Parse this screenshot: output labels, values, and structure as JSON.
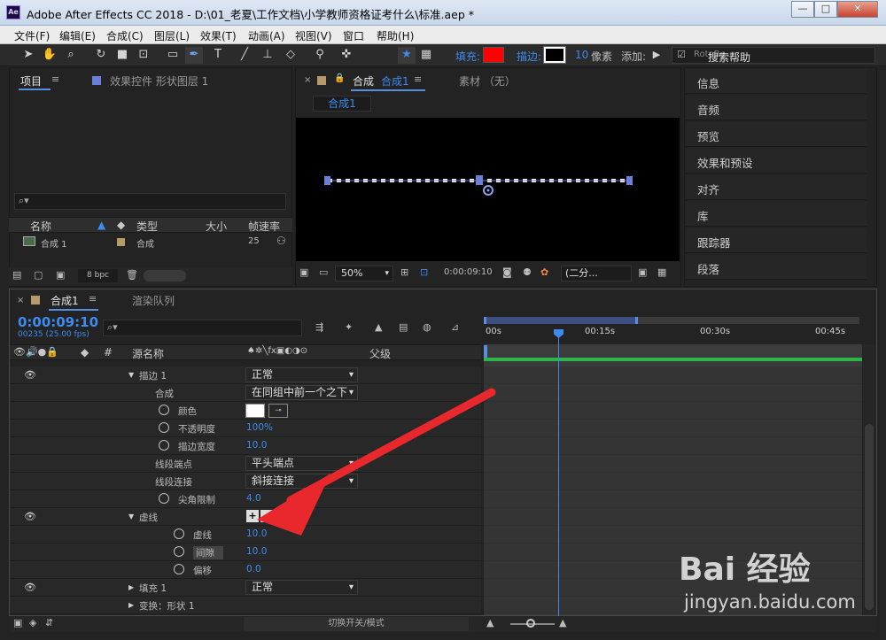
{
  "window": {
    "title": "Adobe After Effects CC 2018 - D:\\01_老夏\\工作文档\\小学教师资格证考什么\\标准.aep *",
    "logo": "Ae"
  },
  "menu": [
    "文件(F)",
    "编辑(E)",
    "合成(C)",
    "图层(L)",
    "效果(T)",
    "动画(A)",
    "视图(V)",
    "窗口",
    "帮助(H)"
  ],
  "toolbar": {
    "fill_label": "填充:",
    "stroke_label": "描边:",
    "stroke_width": "10",
    "stroke_unit": "像素",
    "add_label": "添加:",
    "search_placeholder": "搜索帮助",
    "rotobe_label": "RotoBe",
    "fill_color": "#ff0000",
    "stroke_color": "#000000"
  },
  "project_panel": {
    "tab_project": "项目",
    "tab_effects": "效果控件 形状图层 1",
    "columns": {
      "name": "名称",
      "type": "类型",
      "size": "大小",
      "fps": "帧速率"
    },
    "row": {
      "name": "合成 1",
      "type": "合成",
      "fps": "25"
    },
    "bpc": "8 bpc"
  },
  "comp_panel": {
    "tab_comp_prefix": "合成",
    "tab_comp_name": "合成1",
    "tab_footage": "素材 （无）",
    "breadcrumb": "合成1",
    "zoom": "50%",
    "timecode": "0:00:09:10",
    "resolution": "(二分..."
  },
  "right_panel": {
    "items": [
      "信息",
      "音频",
      "预览",
      "效果和预设",
      "对齐",
      "库",
      "跟踪器",
      "段落"
    ]
  },
  "timeline": {
    "tab_comp": "合成1",
    "tab_render": "渲染队列",
    "timecode": "0:00:09:10",
    "frames": "00235 (25.00 fps)",
    "col_source": "源名称",
    "col_parent": "父级",
    "ruler": [
      "00s",
      "00:15s",
      "00:30s",
      "00:45s"
    ],
    "footer_toggle": "切换开关/模式"
  },
  "layers": [
    {
      "label": "描边 1",
      "value": "正常",
      "kind": "dd"
    },
    {
      "label": "合成",
      "value": "在同组中前一个之下",
      "kind": "dd"
    },
    {
      "label": "颜色",
      "value": "",
      "kind": "color"
    },
    {
      "label": "不透明度",
      "value": "100%",
      "kind": "num"
    },
    {
      "label": "描边宽度",
      "value": "10.0",
      "kind": "num"
    },
    {
      "label": "线段端点",
      "value": "平头端点",
      "kind": "dd"
    },
    {
      "label": "线段连接",
      "value": "斜接连接",
      "kind": "dd"
    },
    {
      "label": "尖角限制",
      "value": "4.0",
      "kind": "num"
    },
    {
      "label": "虚线",
      "value": "",
      "kind": "plusminus"
    },
    {
      "label": "虚线",
      "value": "10.0",
      "kind": "num"
    },
    {
      "label": "间隙",
      "value": "10.0",
      "kind": "num"
    },
    {
      "label": "偏移",
      "value": "0.0",
      "kind": "num"
    },
    {
      "label": "填充 1",
      "value": "正常",
      "kind": "dd"
    },
    {
      "label": "变换：形状 1",
      "value": "",
      "kind": "none"
    }
  ],
  "watermark": {
    "brand": "Bai 经验",
    "url": "jingyan.baidu.com"
  }
}
